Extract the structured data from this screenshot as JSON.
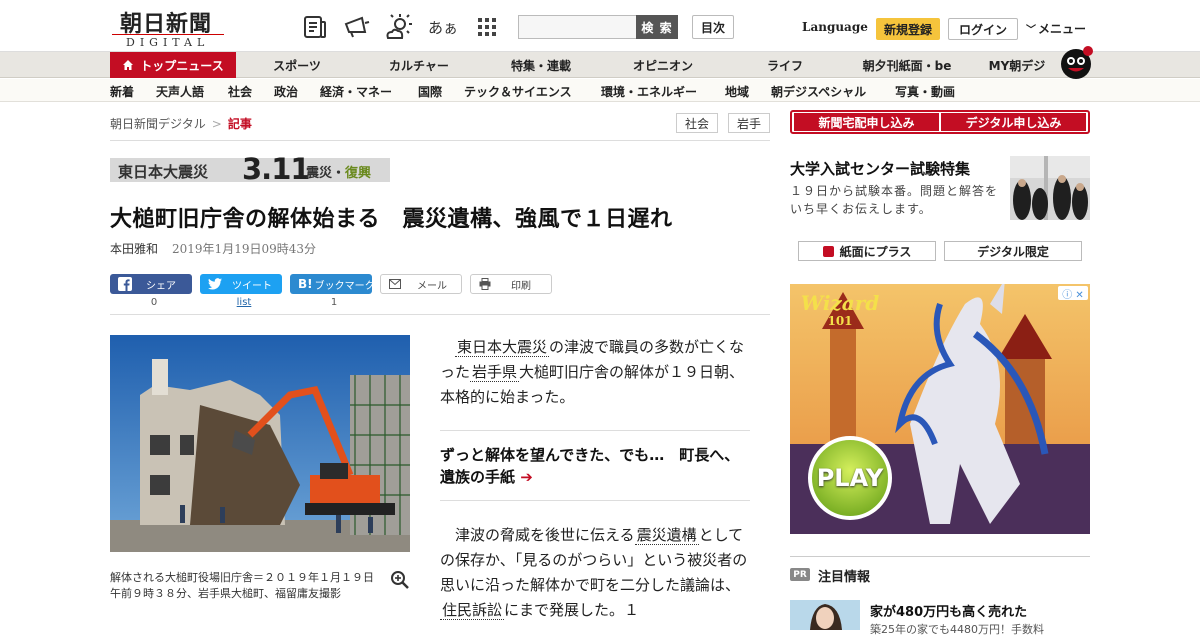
{
  "header": {
    "logo_main": "朝日新聞",
    "logo_sub": "DIGITAL",
    "icons": [
      "newspaper-icon",
      "megaphone-icon",
      "weather-icon",
      "font-size-icon",
      "grid-menu-icon"
    ],
    "font_icon_text": "あぁ",
    "search_placeholder": "",
    "search_button": "検 索",
    "toc_button": "目次",
    "language": "Language",
    "register": "新規登録",
    "login": "ログイン",
    "menu": "メニュー"
  },
  "nav_primary": [
    "トップニュース",
    "スポーツ",
    "カルチャー",
    "特集・連載",
    "オピニオン",
    "ライフ",
    "朝夕刊紙面・be",
    "MY朝デジ"
  ],
  "nav_secondary": [
    "新着",
    "天声人語",
    "社会",
    "政治",
    "経済・マネー",
    "国際",
    "テック＆サイエンス",
    "環境・エネルギー",
    "地域",
    "朝デジスペシャル",
    "写真・動画"
  ],
  "breadcrumb": {
    "root": "朝日新聞デジタル",
    "sep": ">",
    "current": "記事"
  },
  "tags": [
    "社会",
    "岩手"
  ],
  "banner": {
    "part1": "東日本大震災",
    "part2": "3.11",
    "part3a": "震災・",
    "part3b": "復興"
  },
  "article": {
    "headline": "大槌町旧庁舎の解体始まる　震災遺構、強風で１日遅れ",
    "author": "本田雅和",
    "date": "2019年1月19日09時43分",
    "share": [
      {
        "label": "シェア",
        "count": "0",
        "color": "#3b5998",
        "icon": "facebook-icon"
      },
      {
        "label": "ツイート",
        "count": "list",
        "color": "#1da1f2",
        "icon": "twitter-icon"
      },
      {
        "label": "ブックマーク",
        "count": "1",
        "color": "#2c8ad0",
        "icon": "hatena-bookmark-icon"
      },
      {
        "label": "メール",
        "count": "",
        "color": "#ffffff",
        "icon": "mail-icon"
      },
      {
        "label": "印刷",
        "count": "",
        "color": "#ffffff",
        "icon": "print-icon"
      }
    ],
    "caption": "解体される大槌町役場旧庁舎＝２０１９年１月１９日午前９時３８分、岩手県大槌町、福留庸友撮影",
    "p1_before": "東日本大震災",
    "p1_mid1": "の津波で職員の多数が亡くなった",
    "p1_kw2": "岩手県",
    "p1_after": "大槌町旧庁舎の解体が１９日朝、本格的に始まった。",
    "related": "ずっと解体を望んできた、でも…　町長へ、遺族の手紙",
    "related_arrow": "➔",
    "p2_a": "津波の脅威を後世に伝える",
    "p2_kw1": "震災遺構",
    "p2_b": "としての保存か、「見るのがつらい」という被災者の思いに沿った解体かで町を二分した議論は、",
    "p2_kw2": "住民訴訟",
    "p2_c": "にまで発展した。１"
  },
  "sidebar": {
    "subscribe": [
      "新聞宅配申し込み",
      "デジタル申し込み"
    ],
    "promo_title": "大学入試センター試験特集",
    "promo_desc": "１９日から試験本番。問題と解答をいち早くお伝えします。",
    "btn_plus": "紙面にプラス",
    "btn_digital": "デジタル限定",
    "ad": {
      "logo": "Wizard",
      "logo_sub": "101",
      "play": "PLAY",
      "close": "ⓘ ✕"
    },
    "pr_badge": "PR",
    "pr_title": "注目情報",
    "pr_head": "家が480万円も高く売れた",
    "pr_sub": "築25年の家でも4480万円！手数料"
  },
  "colors": {
    "brand_red": "#c30d23",
    "register_yellow": "#f5c43c",
    "nav_bg": "#e8e6e1"
  }
}
